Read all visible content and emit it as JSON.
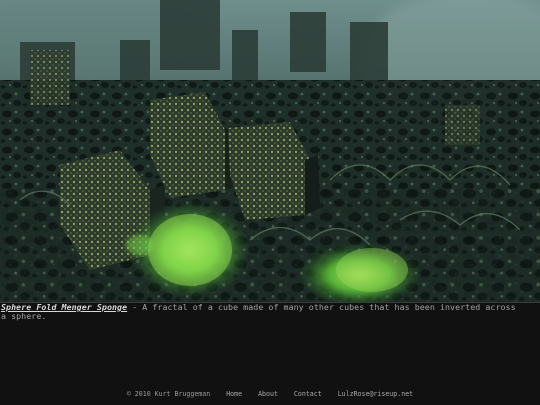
{
  "artwork": {
    "image_semantic": "sphere-fold-menger-sponge-render"
  },
  "caption": {
    "title": "Sphere Fold Menger Sponge",
    "separator": " - ",
    "description": "A fractal of a cube made of many other cubes that has been inverted across a sphere."
  },
  "footer": {
    "copyright": "© 2010 Kurt Bruggeman",
    "links": [
      {
        "label": "Home"
      },
      {
        "label": "About"
      },
      {
        "label": "Contact"
      },
      {
        "label": "LulzRose@riseup.net"
      }
    ]
  },
  "colors": {
    "background": "#111111",
    "caption_text": "#a2a2a2",
    "title_link": "#d8d8d8",
    "fractal_dark": "#1c2a26",
    "fractal_mid": "#4a6a58",
    "glow_green": "#6fd04a",
    "fog": "#7d9a96"
  }
}
